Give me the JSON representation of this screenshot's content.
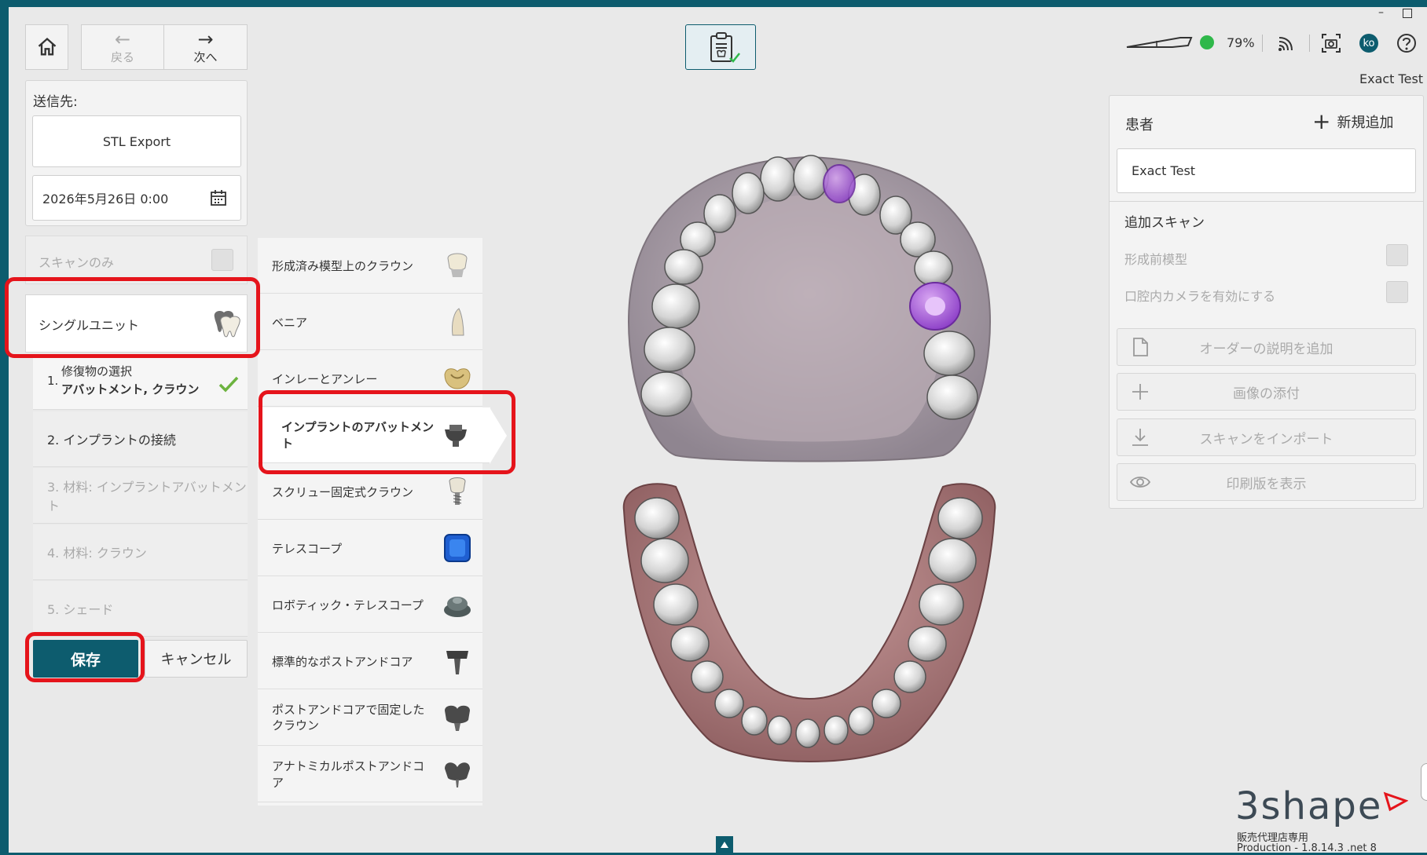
{
  "nav": {
    "home_icon": "home-icon",
    "back_label": "戻る",
    "next_label": "次へ",
    "checklist_icon": "clipboard-check-icon"
  },
  "send_to": {
    "label": "送信先:",
    "destination": "STL Export",
    "datetime": "2026年5月26日  0:00"
  },
  "scan_only": {
    "label": "スキャンのみ"
  },
  "single_unit": {
    "label": "シングルユニット"
  },
  "steps": [
    {
      "num": "1.",
      "line1": "修復物の選択",
      "line2": "アバットメント, クラウン"
    },
    {
      "label": "2. インプラントの接続"
    },
    {
      "label": "3. 材料: インプラントアバットメント"
    },
    {
      "label": "4. 材料: クラウン"
    },
    {
      "label": "5. シェード"
    }
  ],
  "buttons": {
    "save": "保存",
    "cancel": "キャンセル"
  },
  "restorations": [
    {
      "label": "形成済み模型上のクラウン",
      "icon": "crown-on-model-icon"
    },
    {
      "label": "ベニア",
      "icon": "veneer-icon"
    },
    {
      "label": "インレーとアンレー",
      "icon": "inlay-onlay-icon"
    },
    {
      "label": "インプラントのアバットメント",
      "icon": "implant-abutment-icon"
    },
    {
      "label": "スクリュー固定式クラウン",
      "icon": "screw-retained-crown-icon"
    },
    {
      "label": "テレスコープ",
      "icon": "telescope-icon"
    },
    {
      "label": "ロボティック・テレスコープ",
      "icon": "robotic-telescope-icon"
    },
    {
      "label": "標準的なポストアンドコア",
      "icon": "post-and-core-icon"
    },
    {
      "label": "ポストアンドコアで固定したクラウン",
      "icon": "post-core-crown-icon"
    },
    {
      "label": "アナトミカルポストアンドコア",
      "icon": "anatomical-post-core-icon"
    }
  ],
  "status": {
    "battery": "79%",
    "user_initials": "ko",
    "user_name": "Exact Test"
  },
  "patient": {
    "label": "患者",
    "add_new": "新規追加",
    "name": "Exact Test",
    "additional_scans": "追加スキャン",
    "preparation_model": "形成前模型",
    "intraoral_camera": "口腔内カメラを有効にする",
    "actions": [
      {
        "label": "オーダーの説明を追加",
        "icon": "document-icon"
      },
      {
        "label": "画像の添付",
        "icon": "plus-icon"
      },
      {
        "label": "スキャンをインポート",
        "icon": "download-icon"
      },
      {
        "label": "印刷版を表示",
        "icon": "eye-icon"
      }
    ]
  },
  "brand": {
    "logo": "3shape",
    "sub": "販売代理店専用",
    "version": "Production - 1.8.14.3 .net 8"
  },
  "colors": {
    "accent": "#0d5c6e",
    "highlight": "#e5141b",
    "status_ok": "#2fb84a"
  }
}
